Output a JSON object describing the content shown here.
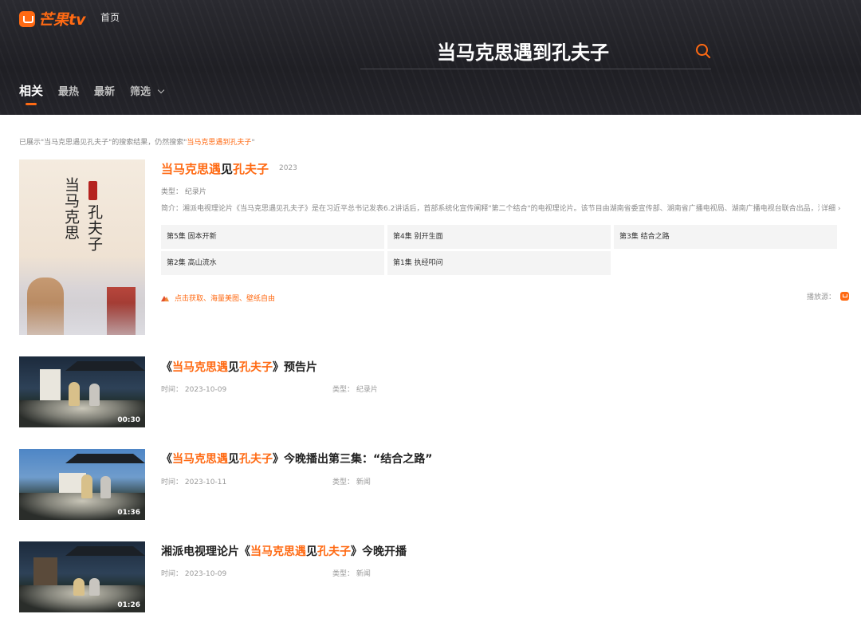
{
  "header": {
    "logo": "芒果tv",
    "nav_home": "首页",
    "search_query": "当马克思遇到孔夫子",
    "tabs": [
      "相关",
      "最热",
      "最新",
      "筛选"
    ]
  },
  "notice": {
    "prefix": "已展示\"当马克思遇见孔夫子\"的搜索结果，仍然搜索\"",
    "link": "当马克思遇到孔夫子",
    "suffix": "\""
  },
  "main_result": {
    "poster_title_line1": "当马克思",
    "poster_title_line2": "孔夫子",
    "poster_seal": "遇见",
    "title_part1": "当马克思遇",
    "title_part2": "见",
    "title_part3": "孔夫子",
    "year": "2023",
    "type": "类型：  纪录片",
    "description": "简介：湘派电视理论片《当马克思遇见孔夫子》是在习近平总书记发表6.2讲话后，首部系统化宣传阐释\"第二个结合\"的电视理论片。该节目由湖南省委宣传部、湖南省广播电视局、湖南广播电视台联合出品，湖南卫...",
    "detail": "详细",
    "episodes": [
      "第5集 固本开新",
      "第4集 别开生面",
      "第3集 结合之路",
      "第2集 高山流水",
      "第1集 执经叩问"
    ],
    "promo": "点击获取、海量美图、壁纸自由",
    "source": "播放源："
  },
  "videos": [
    {
      "title_open": "《",
      "title_hl1": "当马克思遇",
      "title_mid": "见",
      "title_hl2": "孔夫子",
      "title_rest": "》预告片",
      "time": "时间：  2023-10-09",
      "type": "类型：  纪录片",
      "duration": "00:30"
    },
    {
      "title_open": "《",
      "title_hl1": "当马克思遇",
      "title_mid": "见",
      "title_hl2": "孔夫子",
      "title_rest": "》今晚播出第三集：“结合之路”",
      "time": "时间：  2023-10-11",
      "type": "类型：  新闻",
      "duration": "01:36"
    },
    {
      "title_open": "湘派电视理论片《",
      "title_hl1": "当马克思遇",
      "title_mid": "见",
      "title_hl2": "孔夫子",
      "title_rest": "》今晚开播",
      "time": "时间：  2023-10-09",
      "type": "类型：  新闻",
      "duration": "01:26"
    }
  ],
  "colors": {
    "accent": "#ff6a13",
    "header_bg": "#222228"
  }
}
